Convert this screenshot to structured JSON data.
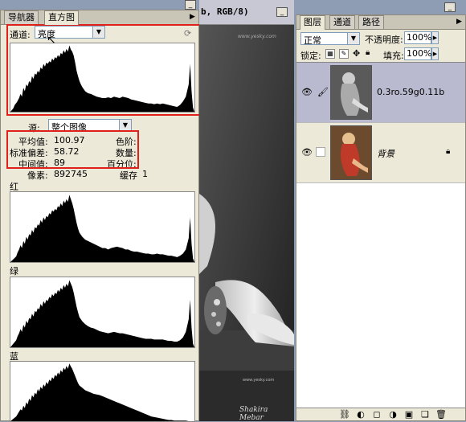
{
  "histogram_panel": {
    "tabs": [
      "导航器",
      "直方图"
    ],
    "channel_label": "通道:",
    "channel_value": "亮度",
    "source_label": "源:",
    "source_value": "整个图像",
    "stats": {
      "mean_label": "平均值:",
      "mean_value": "100.97",
      "std_label": "标准偏差:",
      "std_value": "58.72",
      "median_label": "中间值:",
      "median_value": "89",
      "pixels_label": "像素:",
      "pixels_value": "892745",
      "level_label": "色阶:",
      "count_label": "数量:",
      "percentile_label": "百分位:",
      "cache_label": "缓存",
      "cache_value": "1"
    },
    "channel_labels": [
      "红",
      "绿",
      "蓝"
    ]
  },
  "document_window": {
    "title_fragment": "b, RGB/8)",
    "watermark_top": "www.yesky.com",
    "watermark_bottom": "Shakira Mebar",
    "watermark_side": "www.yesky.com"
  },
  "layers_panel": {
    "tabs": [
      "图层",
      "通道",
      "路径"
    ],
    "blend_mode": "正常",
    "opacity_label": "不透明度:",
    "opacity_value": "100%",
    "lock_label": "锁定:",
    "fill_label": "填充:",
    "fill_value": "100%",
    "layers": [
      {
        "name": "0.3ro.59g0.11b",
        "selected": true
      },
      {
        "name": "背景",
        "selected": false
      }
    ],
    "accent_color": "#b9b9cf"
  },
  "annotation_color": "#e0201a"
}
